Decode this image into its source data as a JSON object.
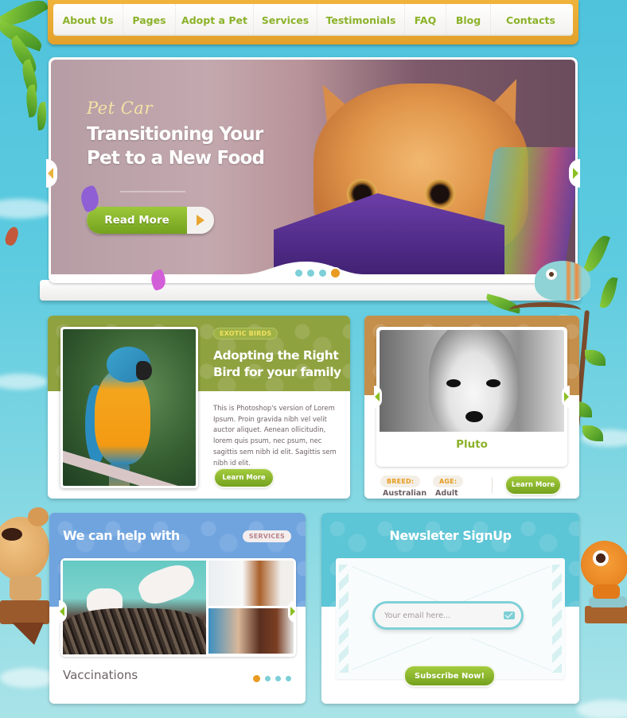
{
  "nav": {
    "items": [
      {
        "label": "About Us"
      },
      {
        "label": "Pages"
      },
      {
        "label": "Adopt a Pet"
      },
      {
        "label": "Services"
      },
      {
        "label": "Testimonials"
      },
      {
        "label": "FAQ"
      },
      {
        "label": "Blog"
      },
      {
        "label": "Contacts"
      }
    ]
  },
  "hero": {
    "script_label": "Pet Car",
    "title_line1": "Transitioning Your",
    "title_line2": "Pet to a New Food",
    "button_label": "Read More",
    "slides_total": 4,
    "active_slide": 4,
    "prev_icon": "chevron-left-icon",
    "next_icon": "chevron-right-icon"
  },
  "bird_card": {
    "badge": "EXOTIC BIRDS",
    "title_line1": "Adopting the Right",
    "title_line2": "Bird for your family",
    "body": "This is Photoshop's version of Lorem Ipsum. Proin gravida nibh vel velit auctor aliquet. Aenean ollicitudin, lorem quis psum, nec psum, nec sagittis sem nibh id elit. Sagittis sem nibh id elit.",
    "button_label": "Learn More"
  },
  "pet_card": {
    "name": "Pluto",
    "breed_label": "BREED:",
    "breed_value": "Australian",
    "age_label": "AGE:",
    "age_value": "Adult",
    "button_label": "Learn More"
  },
  "services_card": {
    "title": "We can help with",
    "badge": "SERVICES",
    "caption": "Vaccinations",
    "slides_total": 4,
    "active_slide": 1
  },
  "newsletter": {
    "title": "Newsleter SignUp",
    "email_placeholder": "Your email here...",
    "email_value": "",
    "button_label": "Subscribe Now!"
  },
  "colors": {
    "accent_green": "#8bb22a",
    "accent_orange": "#e89b22",
    "nav_frame": "#e3a12a",
    "bird_header": "#8ea23f",
    "pet_header": "#c48f4b",
    "services_header": "#6fa4df",
    "newsletter_header": "#5cc5d6",
    "sky": "#4fc3dc"
  }
}
